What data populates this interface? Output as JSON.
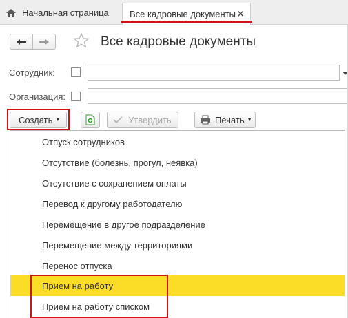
{
  "tabs": {
    "home_label": "Начальная страница",
    "active_label": "Все кадровые документы",
    "close": "✕"
  },
  "header": {
    "title": "Все кадровые документы"
  },
  "filters": {
    "employee_label": "Сотрудник:",
    "organization_label": "Организация:"
  },
  "toolbar": {
    "create_label": "Создать",
    "approve_label": "Утвердить",
    "print_label": "Печать"
  },
  "menu": {
    "items": [
      "Отпуск сотрудников",
      "Отсутствие (болезнь, прогул, неявка)",
      "Отсутствие с сохранением оплаты",
      "Перевод к другому работодателю",
      "Перемещение в другое подразделение",
      "Перемещение между территориями",
      "Перенос отпуска",
      "Прием на работу",
      "Прием на работу списком"
    ],
    "selected_index": 7
  },
  "colors": {
    "highlight_red": "#d0121b",
    "selection_yellow": "#fbdc26"
  }
}
